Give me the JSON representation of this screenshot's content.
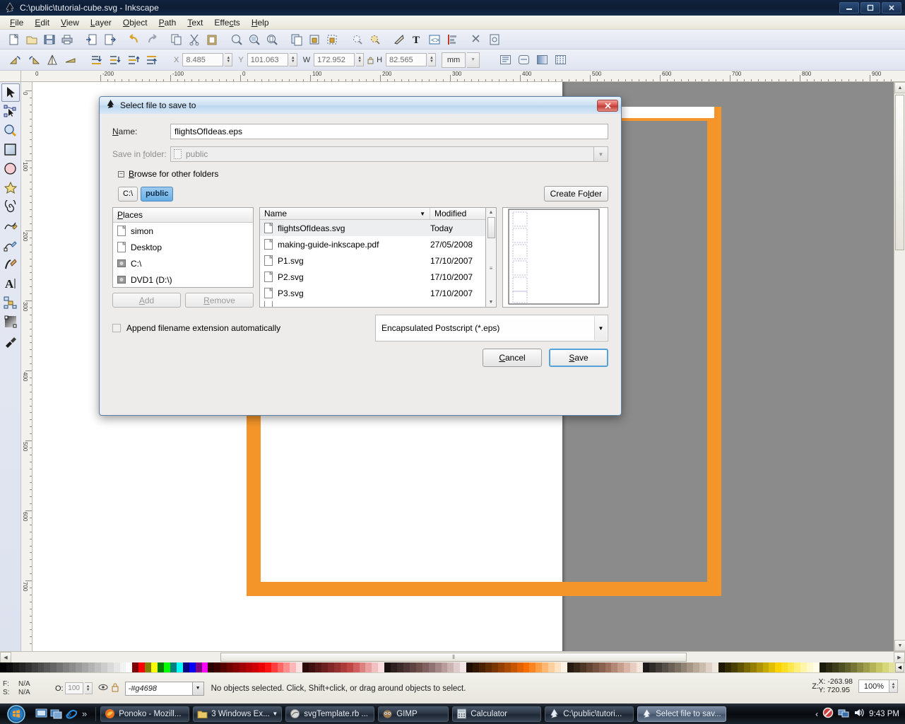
{
  "window": {
    "title": "C:\\public\\tutorial-cube.svg - Inkscape",
    "icon": "inkscape-icon",
    "minimize": "–",
    "maximize": "❐",
    "close": "✕"
  },
  "menubar": [
    {
      "label": "File",
      "mnemonic": "F"
    },
    {
      "label": "Edit",
      "mnemonic": "E"
    },
    {
      "label": "View",
      "mnemonic": "V"
    },
    {
      "label": "Layer",
      "mnemonic": "L"
    },
    {
      "label": "Object",
      "mnemonic": "O"
    },
    {
      "label": "Path",
      "mnemonic": "P"
    },
    {
      "label": "Text",
      "mnemonic": "T"
    },
    {
      "label": "Effects",
      "mnemonic": "c"
    },
    {
      "label": "Help",
      "mnemonic": "H"
    }
  ],
  "toolbar": {
    "icons": [
      "new-document-icon",
      "open-document-icon",
      "save-document-icon",
      "print-icon",
      "import-icon",
      "export-icon",
      "undo-icon",
      "redo-icon",
      "copy-icon",
      "cut-icon",
      "paste-icon",
      "zoom-selection-icon",
      "zoom-drawing-icon",
      "zoom-page-icon",
      "duplicate-icon",
      "group-icon",
      "ungroup-icon",
      "xml-editor-icon",
      "align-objects-icon",
      "fill-stroke-icon",
      "text-tool-icon",
      "xml-tree-icon",
      "align-panel-icon",
      "preferences-icon",
      "document-properties-icon"
    ]
  },
  "tool_options": {
    "transform_icons": [
      "rotate-90-ccw-icon",
      "rotate-90-cw-icon",
      "flip-horizontal-icon",
      "flip-vertical-icon",
      "lower-to-bottom-icon",
      "lower-icon",
      "raise-icon",
      "raise-to-top-icon"
    ],
    "x_label": "X",
    "x_value": "8.485",
    "y_label": "Y",
    "y_value": "101.063",
    "w_label": "W",
    "w_value": "172.952",
    "lock_icon": "lock-aspect-icon",
    "h_label": "H",
    "h_value": "82.565",
    "unit": "mm",
    "affect_icons": [
      "affect-stroke-width-icon",
      "affect-rounded-corners-icon",
      "affect-gradients-icon",
      "affect-patterns-icon"
    ]
  },
  "toolbox": {
    "tools": [
      {
        "name": "selector-tool",
        "active": true
      },
      {
        "name": "node-tool",
        "active": false
      },
      {
        "name": "zoom-tool",
        "active": false
      },
      {
        "name": "rectangle-tool",
        "active": false
      },
      {
        "name": "ellipse-tool",
        "active": false
      },
      {
        "name": "star-tool",
        "active": false
      },
      {
        "name": "spiral-tool",
        "active": false
      },
      {
        "name": "pencil-tool",
        "active": false
      },
      {
        "name": "bezier-pen-tool",
        "active": false
      },
      {
        "name": "calligraphy-tool",
        "active": false
      },
      {
        "name": "text-tool",
        "active": false
      },
      {
        "name": "connector-tool",
        "active": false
      },
      {
        "name": "gradient-tool",
        "active": false
      },
      {
        "name": "dropper-tool",
        "active": false
      }
    ]
  },
  "rulers": {
    "horizontal_labels": [
      "0",
      "-200",
      "-100",
      "0",
      "100",
      "200",
      "300",
      "400",
      "500",
      "600",
      "700",
      "800",
      "900"
    ],
    "vertical_labels": [
      "0",
      "100",
      "200",
      "300",
      "400",
      "500",
      "600",
      "700"
    ]
  },
  "canvas": {
    "page_color": "#ffffff",
    "frame_color": "#f49529",
    "background_color": "#8b8b8b"
  },
  "dialog": {
    "title": "Select file to save to",
    "icon": "inkscape-icon",
    "close_label": "✕",
    "name_label": "Name:",
    "name_mnemonic": "N",
    "name_value": "flightsOfIdeas.eps",
    "folder_label": "Save in folder:",
    "folder_mnemonic": "f",
    "folder_value": "public",
    "expander_label": "Browse for other folders",
    "expander_mnemonic": "B",
    "expander_state": "−",
    "breadcrumbs": [
      {
        "label": "C:\\",
        "active": false
      },
      {
        "label": "public",
        "active": true
      }
    ],
    "create_folder_label": "Create Folder",
    "create_folder_mnemonic": "l",
    "places_header": "Places",
    "places_mnemonic": "P",
    "places": [
      {
        "label": "simon",
        "icon": "folder-icon"
      },
      {
        "label": "Desktop",
        "icon": "folder-icon"
      },
      {
        "label": "C:\\",
        "icon": "drive-icon"
      },
      {
        "label": "DVD1 (D:\\)",
        "icon": "drive-icon"
      }
    ],
    "add_label": "Add",
    "add_mnemonic": "A",
    "remove_label": "Remove",
    "remove_mnemonic": "R",
    "file_columns": [
      "Name",
      "Modified"
    ],
    "sort_indicator": "▼",
    "files": [
      {
        "name": "flightsOfIdeas.svg",
        "modified": "Today",
        "icon": "file-icon",
        "selected": true
      },
      {
        "name": "making-guide-inkscape.pdf",
        "modified": "27/05/2008",
        "icon": "file-icon",
        "selected": false
      },
      {
        "name": "P1.svg",
        "modified": "17/10/2007",
        "icon": "file-icon",
        "selected": false
      },
      {
        "name": "P2.svg",
        "modified": "17/10/2007",
        "icon": "file-icon",
        "selected": false
      },
      {
        "name": "P3.svg",
        "modified": "17/10/2007",
        "icon": "file-icon",
        "selected": false
      }
    ],
    "append_extension_label": "Append filename extension automatically",
    "append_extension_checked": false,
    "filetype_value": "Encapsulated Postscript (*.eps)",
    "cancel_label": "Cancel",
    "cancel_mnemonic": "C",
    "save_label": "Save",
    "save_mnemonic": "S"
  },
  "statusbar": {
    "fill_label": "F:",
    "stroke_label": "S:",
    "fill_value": "N/A",
    "stroke_value": "N/A",
    "opacity_label": "O:",
    "opacity_value": "100",
    "eye_icon": "visibility-icon",
    "lock_icon": "layer-lock-icon",
    "layer_value": "-#g4698",
    "message": "No objects selected. Click, Shift+click, or drag around objects to select.",
    "x_coord": "X: -263.98",
    "y_coord": "Y: 720.95",
    "zoom_label": "Z:",
    "zoom_value": "100%"
  },
  "palette": {
    "colors": [
      "#000000",
      "#0d0d0d",
      "#1a1a1a",
      "#262626",
      "#333333",
      "#404040",
      "#4d4d4d",
      "#595959",
      "#666666",
      "#737373",
      "#808080",
      "#8c8c8c",
      "#999999",
      "#a6a6a6",
      "#b3b3b3",
      "#bfbfbf",
      "#cccccc",
      "#d9d9d9",
      "#e6e6e6",
      "#f2f2f2",
      "#ffffff",
      "#800000",
      "#ff0000",
      "#808000",
      "#ffff00",
      "#008000",
      "#00ff00",
      "#008080",
      "#00ffff",
      "#000080",
      "#0000ff",
      "#800080",
      "#ff00ff",
      "#2b0000",
      "#3d0000",
      "#550000",
      "#6e0000",
      "#870000",
      "#a00000",
      "#b80000",
      "#d10000",
      "#ea0000",
      "#ff1414",
      "#ff3d3d",
      "#ff6666",
      "#ff8f8f",
      "#ffb8b8",
      "#ffe0e0",
      "#2b0a0a",
      "#401010",
      "#551717",
      "#6b1f1f",
      "#802727",
      "#963030",
      "#ab3a3a",
      "#c04545",
      "#d15f5f",
      "#dd8080",
      "#e8a0a0",
      "#f2c0c0",
      "#faddde",
      "#1a1010",
      "#2e2020",
      "#3d2a2a",
      "#4f3636",
      "#5f4242",
      "#70504d",
      "#806060",
      "#917272",
      "#a48787",
      "#b89c9c",
      "#ccb3b3",
      "#e0cccc",
      "#f0e4e4",
      "#1d0d00",
      "#331600",
      "#4a2100",
      "#612b00",
      "#7a3600",
      "#944100",
      "#ad4c00",
      "#c65700",
      "#e06200",
      "#fa6e00",
      "#ff8522",
      "#ff9f47",
      "#ffb873",
      "#ffcf9e",
      "#ffe3c4",
      "#fff3e6",
      "#241a0f",
      "#38281a",
      "#4d3626",
      "#614433",
      "#755340",
      "#8a624f",
      "#9e725f",
      "#b38775",
      "#c79d8c",
      "#d9b5a6",
      "#e8cec2",
      "#f5e6dd",
      "#1a1a1a",
      "#2e2b28",
      "#423d38",
      "#564f47",
      "#6b6056",
      "#7d7164",
      "#918375",
      "#a59686",
      "#b8a998",
      "#cbbdae",
      "#ded2c6",
      "#efe6dd",
      "#1e1a00",
      "#332d00",
      "#4a4100",
      "#615400",
      "#7a6a00",
      "#947f00",
      "#ad9400",
      "#c6a900",
      "#e0be00",
      "#fad300",
      "#ffdf1f",
      "#ffe84f",
      "#ffef7d",
      "#fff4a8",
      "#fff9cf",
      "#fffce8",
      "#1a1a0d",
      "#2b2b14",
      "#3d3d1c",
      "#4f4f24",
      "#61612d",
      "#757538",
      "#8a8a42",
      "#9e9e4d",
      "#b3b359",
      "#c7c765",
      "#d6d67a",
      "#e2e29a"
    ]
  },
  "taskbar": {
    "start_icon": "windows-start-orb",
    "quick_launch": [
      "show-desktop-icon",
      "switch-windows-icon",
      "internet-explorer-icon"
    ],
    "overflow": "»",
    "tasks": [
      {
        "label": "Ponoko - Mozill...",
        "icon": "firefox-icon",
        "active": false,
        "has_arrow": false
      },
      {
        "label": "3 Windows Ex...",
        "icon": "folder-icon",
        "active": false,
        "has_arrow": true
      },
      {
        "label": "svgTemplate.rb ...",
        "icon": "app-icon",
        "active": false,
        "has_arrow": false
      },
      {
        "label": "GIMP",
        "icon": "gimp-icon",
        "active": false,
        "has_arrow": false
      },
      {
        "label": "Calculator",
        "icon": "calculator-icon",
        "active": false,
        "has_arrow": false
      },
      {
        "label": "C:\\public\\tutori...",
        "icon": "inkscape-icon",
        "active": false,
        "has_arrow": false
      },
      {
        "label": "Select file to sav...",
        "icon": "inkscape-icon",
        "active": true,
        "has_arrow": false
      }
    ],
    "tray": {
      "expand": "‹",
      "icons": [
        "action-center-icon",
        "network-icon",
        "volume-icon"
      ],
      "clock": "9:43 PM"
    }
  }
}
